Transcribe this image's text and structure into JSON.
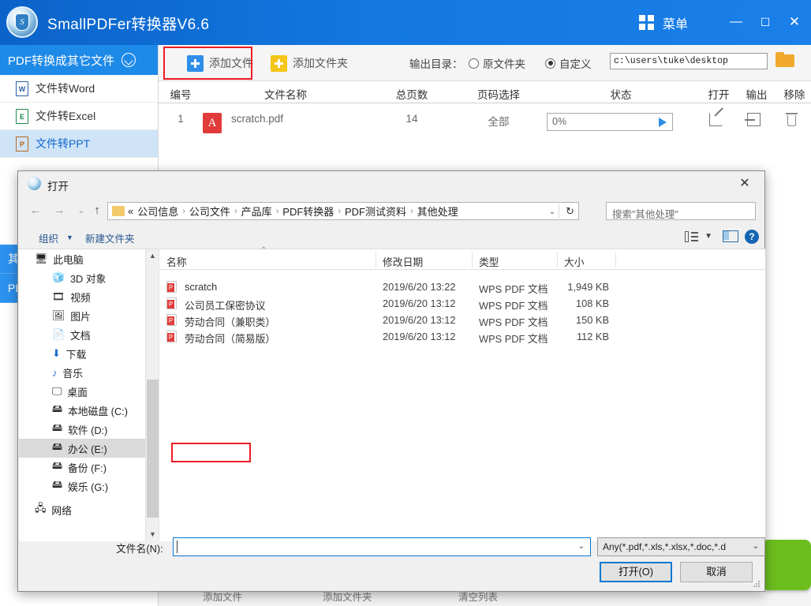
{
  "app": {
    "title": "SmallPDFer转换器V6.6",
    "menu_label": "菜单",
    "window_buttons": {
      "minimize": "—",
      "maximize": "☐",
      "close": "✕"
    }
  },
  "sidebar": {
    "header": "PDF转换成其它文件",
    "items": [
      {
        "label": "文件转Word",
        "icon": "word-doc-icon",
        "badge": "W",
        "active": false
      },
      {
        "label": "文件转Excel",
        "icon": "excel-doc-icon",
        "badge": "E",
        "active": false
      },
      {
        "label": "文件转PPT",
        "icon": "ppt-doc-icon",
        "badge": "P",
        "active": true
      }
    ],
    "sections": [
      {
        "label": "其它"
      },
      {
        "label": "PDF"
      }
    ]
  },
  "toolbar": {
    "add_file": "添加文件",
    "add_folder": "添加文件夹",
    "output_dir_label": "输出目录：",
    "radio_original": "原文件夹",
    "radio_custom": "自定义",
    "output_path": "c:\\users\\tuke\\desktop",
    "selected_radio": "自定义"
  },
  "table": {
    "headers": {
      "no": "编号",
      "filename": "文件名称",
      "pages": "总页数",
      "page_select": "页码选择",
      "status": "状态",
      "open": "打开",
      "output": "输出",
      "remove": "移除"
    },
    "rows": [
      {
        "no": "1",
        "filename": "scratch.pdf",
        "pages": "14",
        "page_select": "全部",
        "progress": "0%"
      }
    ]
  },
  "bottombar": {
    "add_file": "添加文件",
    "add_folder": "添加文件夹",
    "clear_list": "清空列表"
  },
  "dialog": {
    "title": "打开",
    "close": "✕",
    "nav": {
      "back": "←",
      "forward": "→",
      "recent": "⌄",
      "up": "↑"
    },
    "breadcrumb": {
      "prefix": "«",
      "items": [
        "公司信息",
        "公司文件",
        "产品库",
        "PDF转换器",
        "PDF测试资料",
        "其他处理"
      ],
      "separator": "›"
    },
    "refresh": "↻",
    "search_placeholder": "搜索\"其他处理\"",
    "commands": {
      "organize": "组织",
      "new_folder": "新建文件夹"
    },
    "nav_pane": [
      {
        "label": "此电脑",
        "icon": "computer-icon",
        "indent": false,
        "selected": false
      },
      {
        "label": "3D 对象",
        "icon": "3d-objects-icon",
        "indent": true,
        "selected": false
      },
      {
        "label": "视频",
        "icon": "videos-icon",
        "indent": true,
        "selected": false
      },
      {
        "label": "图片",
        "icon": "pictures-icon",
        "indent": true,
        "selected": false
      },
      {
        "label": "文档",
        "icon": "documents-icon",
        "indent": true,
        "selected": false
      },
      {
        "label": "下载",
        "icon": "downloads-icon",
        "indent": true,
        "selected": false
      },
      {
        "label": "音乐",
        "icon": "music-icon",
        "indent": true,
        "selected": false
      },
      {
        "label": "桌面",
        "icon": "desktop-icon",
        "indent": true,
        "selected": false
      },
      {
        "label": "本地磁盘 (C:)",
        "icon": "drive-windows-icon",
        "indent": true,
        "selected": false
      },
      {
        "label": "软件 (D:)",
        "icon": "drive-icon",
        "indent": true,
        "selected": false
      },
      {
        "label": "办公 (E:)",
        "icon": "drive-icon",
        "indent": true,
        "selected": true
      },
      {
        "label": "备份 (F:)",
        "icon": "drive-icon",
        "indent": true,
        "selected": false
      },
      {
        "label": "娱乐 (G:)",
        "icon": "drive-icon",
        "indent": true,
        "selected": false
      },
      {
        "label": "网络",
        "icon": "network-icon",
        "indent": false,
        "selected": false
      }
    ],
    "file_headers": {
      "name": "名称",
      "date": "修改日期",
      "type": "类型",
      "size": "大小"
    },
    "files": [
      {
        "name": "scratch",
        "date": "2019/6/20 13:22",
        "type": "WPS PDF 文档",
        "size": "1,949 KB"
      },
      {
        "name": "公司员工保密协议",
        "date": "2019/6/20 13:12",
        "type": "WPS PDF 文档",
        "size": "108 KB"
      },
      {
        "name": "劳动合同（兼职类）",
        "date": "2019/6/20 13:12",
        "type": "WPS PDF 文档",
        "size": "150 KB"
      },
      {
        "name": "劳动合同（简易版）",
        "date": "2019/6/20 13:12",
        "type": "WPS PDF 文档",
        "size": "112 KB"
      }
    ],
    "filename_label": "文件名(N):",
    "filename_value": "",
    "filetype_value": "Any(*.pdf,*.xls,*.xlsx,*.doc,*.d",
    "open_button": "打开(O)",
    "cancel_button": "取消"
  },
  "colors": {
    "brand_blue": "#1277e0",
    "accent_blue": "#2f8fe8",
    "highlight_red": "#ee1c25",
    "green_action": "#6cbe1e",
    "pdf_red": "#e23b3b"
  }
}
